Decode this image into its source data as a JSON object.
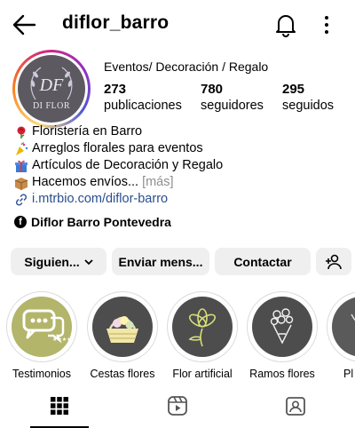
{
  "header": {
    "username": "diflor_barro",
    "back_icon": "arrow-left-icon",
    "notifications_icon": "bell-icon",
    "more_icon": "more-vertical-icon"
  },
  "profile": {
    "avatar_text": "DI FLOR",
    "avatar_monogram": "DF",
    "category": "Eventos/ Decoración / Regalo",
    "stats": [
      {
        "value": "273",
        "label": "publicaciones"
      },
      {
        "value": "780",
        "label": "seguidores"
      },
      {
        "value": "295",
        "label": "seguidos"
      }
    ]
  },
  "bio": {
    "lines": [
      {
        "icon": "rose-emoji",
        "text": "Floristería en Barro"
      },
      {
        "icon": "party-popper-emoji",
        "text": "Arreglos florales para eventos"
      },
      {
        "icon": "gift-emoji",
        "text": "Artículos de Decoración y Regalo"
      },
      {
        "icon": "package-emoji",
        "text": "Hacemos envíos..."
      }
    ],
    "more_label": "[más]",
    "link": "i.mtrbio.com/diflor-barro",
    "facebook_page": "Diflor Barro Pontevedra"
  },
  "actions": {
    "following_label": "Siguien...",
    "message_label": "Enviar mens...",
    "contact_label": "Contactar",
    "suggest_icon": "add-person-icon"
  },
  "highlights": [
    {
      "label": "Testimonios",
      "icon": "chat-bubbles-icon"
    },
    {
      "label": "Cestas flores",
      "icon": "basket-icon"
    },
    {
      "label": "Flor artificial",
      "icon": "flower-icon"
    },
    {
      "label": "Ramos flores",
      "icon": "bouquet-icon"
    },
    {
      "label": "Pl",
      "icon": "plant-icon"
    }
  ],
  "tabs": [
    {
      "name": "grid",
      "icon": "grid-icon",
      "active": true
    },
    {
      "name": "reels",
      "icon": "reels-icon",
      "active": false
    },
    {
      "name": "tagged",
      "icon": "tagged-icon",
      "active": false
    }
  ],
  "colors": {
    "link": "#2a4d8f",
    "button_bg": "#efefef",
    "highlight_green": "#b3b56a",
    "highlight_dark": "#4d4d4d"
  }
}
